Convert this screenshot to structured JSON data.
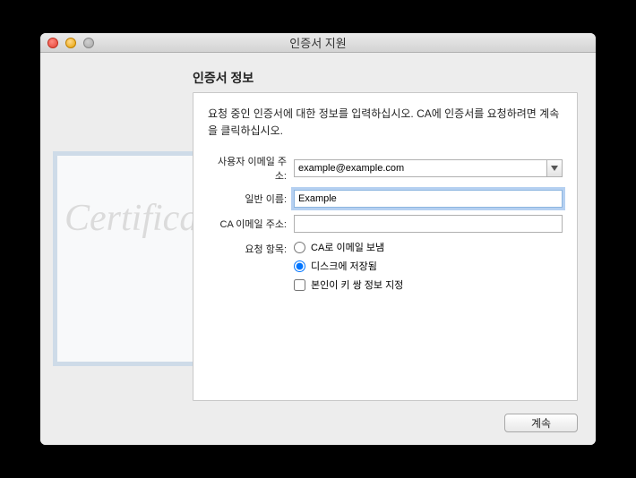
{
  "window": {
    "title": "인증서 지원"
  },
  "section": {
    "title": "인증서 정보",
    "instruction": "요청 중인 인증서에 대한 정보를 입력하십시오. CA에 인증서를 요청하려면 계속을 클릭하십시오."
  },
  "form": {
    "email_label": "사용자 이메일 주소:",
    "email_value": "example@example.com",
    "name_label": "일반 이름:",
    "name_value": "Example",
    "ca_email_label": "CA 이메일 주소:",
    "ca_email_value": "",
    "request_label": "요청 항목:",
    "radio_email_ca": "CA로 이메일 보냄",
    "radio_save_disk": "디스크에 저장됨",
    "checkbox_keypair": "본인이 키 쌍 정보 지정"
  },
  "footer": {
    "continue": "계속"
  },
  "background": {
    "cert_text": "Certificate"
  }
}
